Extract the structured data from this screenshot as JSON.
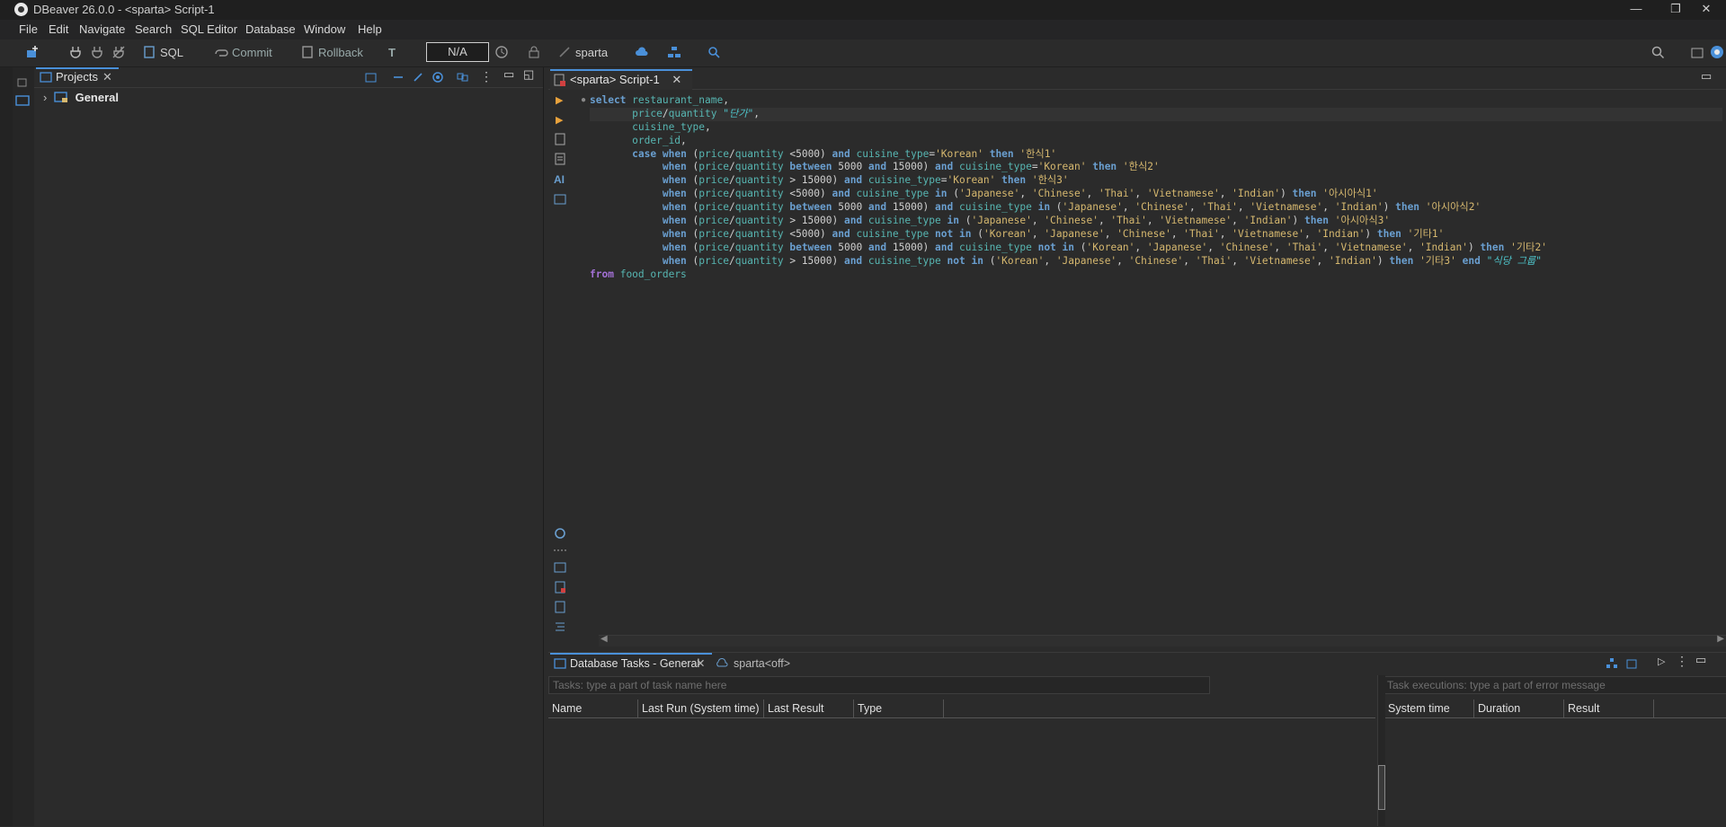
{
  "window": {
    "title": "DBeaver 26.0.0 - <sparta> Script-1",
    "minimize_glyph": "—",
    "maximize_glyph": "❐",
    "close_glyph": "✕"
  },
  "menu": [
    "File",
    "Edit",
    "Navigate",
    "Search",
    "SQL Editor",
    "Database",
    "Window",
    "Help"
  ],
  "toolbar": {
    "sql_label": "SQL",
    "commit_label": "Commit",
    "rollback_label": "Rollback",
    "transaction_mode": "N/A",
    "datasource": "sparta"
  },
  "projects_panel": {
    "tab_label": "Projects",
    "tree_root": "General"
  },
  "editor": {
    "tab_label": "<sparta> Script-1",
    "gutter_ai_label": "AI",
    "code_lines": [
      "select restaurant_name,",
      "       price/quantity \"단가\",",
      "       cuisine_type,",
      "       order_id,",
      "       case when (price/quantity <5000) and cuisine_type='Korean' then '한식1'",
      "            when (price/quantity between 5000 and 15000) and cuisine_type='Korean' then '한식2'",
      "            when (price/quantity > 15000) and cuisine_type='Korean' then '한식3'",
      "            when (price/quantity <5000) and cuisine_type in ('Japanese', 'Chinese', 'Thai', 'Vietnamese', 'Indian') then '아시아식1'",
      "            when (price/quantity between 5000 and 15000) and cuisine_type in ('Japanese', 'Chinese', 'Thai', 'Vietnamese', 'Indian') then '아시아식2'",
      "            when (price/quantity > 15000) and cuisine_type in ('Japanese', 'Chinese', 'Thai', 'Vietnamese', 'Indian') then '아시아식3'",
      "            when (price/quantity <5000) and cuisine_type not in ('Korean', 'Japanese', 'Chinese', 'Thai', 'Vietnamese', 'Indian') then '기타1'",
      "            when (price/quantity between 5000 and 15000) and cuisine_type not in ('Korean', 'Japanese', 'Chinese', 'Thai', 'Vietnamese', 'Indian') then '기타2'",
      "            when (price/quantity > 15000) and cuisine_type not in ('Korean', 'Japanese', 'Chinese', 'Thai', 'Vietnamese', 'Indian') then '기타3' end \"식당 그룹\"",
      "from food_orders"
    ]
  },
  "bottom_panel": {
    "tasks_tab": "Database Tasks - General",
    "connection_tab": "sparta<off>",
    "tasks_filter_placeholder": "Tasks: type a part of task name here",
    "executions_filter_placeholder": "Task executions: type a part of error message",
    "tasks_columns": [
      "Name",
      "Last Run (System time)",
      "Last Result",
      "Type"
    ],
    "executions_columns": [
      "System time",
      "Duration",
      "Result"
    ]
  },
  "colors": {
    "keyword": "#6a9fd0",
    "identifier": "#57b6b2",
    "string": "#d6b86f",
    "alias": "#4ec3c9",
    "from_keyword": "#a371d6",
    "accent": "#4a90d9"
  }
}
